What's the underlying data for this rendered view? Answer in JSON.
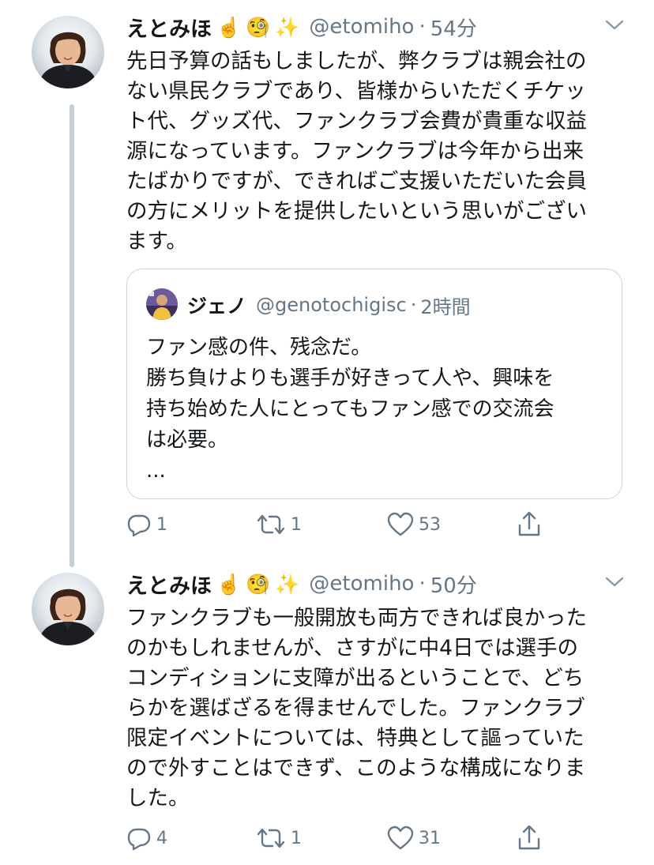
{
  "thread": [
    {
      "name": "えとみほ",
      "emojis": [
        "☝️",
        "🧐",
        "✨"
      ],
      "handle": "@etomiho",
      "separator": "·",
      "time": "54分",
      "lines": [
        "先日予算の話もしましたが、弊クラブは親会社の",
        "ない県民クラブであり、皆様からいただくチケッ",
        "ト代、グッズ代、ファンクラブ会費が貴重な収益",
        "源になっています。ファンクラブは今年から出来",
        "たばかりですが、できればご支援いただいた会員",
        "の方にメリットを提供したいという思いがござい",
        "ます。"
      ],
      "quote": {
        "name": "ジェノ",
        "handle": "@genotochigisc",
        "separator": "·",
        "time": "2時間",
        "lines": [
          "ファン感の件、残念だ。",
          "勝ち負けよりも選手が好きって人や、興味を",
          "持ち始めた人にとってもファン感での交流会",
          "は必要。",
          "..."
        ]
      },
      "actions": {
        "replies": "1",
        "retweets": "1",
        "likes": "53"
      }
    },
    {
      "name": "えとみほ",
      "emojis": [
        "☝️",
        "🧐",
        "✨"
      ],
      "handle": "@etomiho",
      "separator": "·",
      "time": "50分",
      "lines": [
        "ファンクラブも一般開放も両方できれば良かった",
        "のかもしれませんが、さすがに中4日では選手の",
        "コンディションに支障が出るということで、どち",
        "らかを選ばざるを得ませんでした。ファンクラブ",
        "限定イベントについては、特典として謳っていた",
        "ので外すことはできず、このような構成になりま",
        "した。"
      ],
      "actions": {
        "replies": "4",
        "retweets": "1",
        "likes": "31"
      }
    }
  ],
  "colors": {
    "text": "#14171a",
    "secondary": "#657786",
    "border": "#ccd6dd",
    "thread_line": "#c4cfd6"
  },
  "icons": [
    "avatar",
    "chevron-down-icon",
    "reply-icon",
    "retweet-icon",
    "like-icon",
    "share-icon"
  ]
}
